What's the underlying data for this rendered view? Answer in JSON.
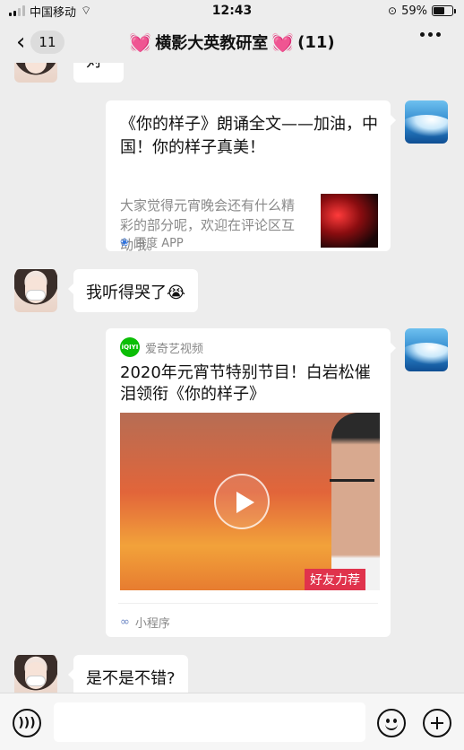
{
  "status_bar": {
    "carrier": "中国移动",
    "time": "12:43",
    "battery": "59%",
    "battery_level": 0.59
  },
  "nav": {
    "unread_count": "11",
    "title": "横影大英教研室",
    "member_count": "(11)"
  },
  "messages": [
    {
      "type": "text",
      "from": "other",
      "text": "对"
    },
    {
      "type": "link_card",
      "from": "self",
      "title": "《你的样子》朗诵全文——加油，中国！你的样子真美！",
      "description": "大家觉得元宵晚会还有什么精彩的部分呢，欢迎在评论区互动哦。",
      "source": "百度 APP"
    },
    {
      "type": "text",
      "from": "other",
      "text": "我听得哭了😭"
    },
    {
      "type": "video_card",
      "from": "self",
      "app_name": "爱奇艺视频",
      "logo_text": "iQIYI",
      "title": "2020年元宵节特别节目！白岩松催泪领衔《你的样子》",
      "badge": "好友力荐",
      "footer": "小程序"
    },
    {
      "type": "text",
      "from": "other",
      "text": "是不是不错?"
    }
  ],
  "input": {
    "value": ""
  },
  "colors": {
    "background": "#ededed",
    "bubble": "#ffffff",
    "badge": "#e0334c",
    "iqiyi": "#0bbe06"
  }
}
